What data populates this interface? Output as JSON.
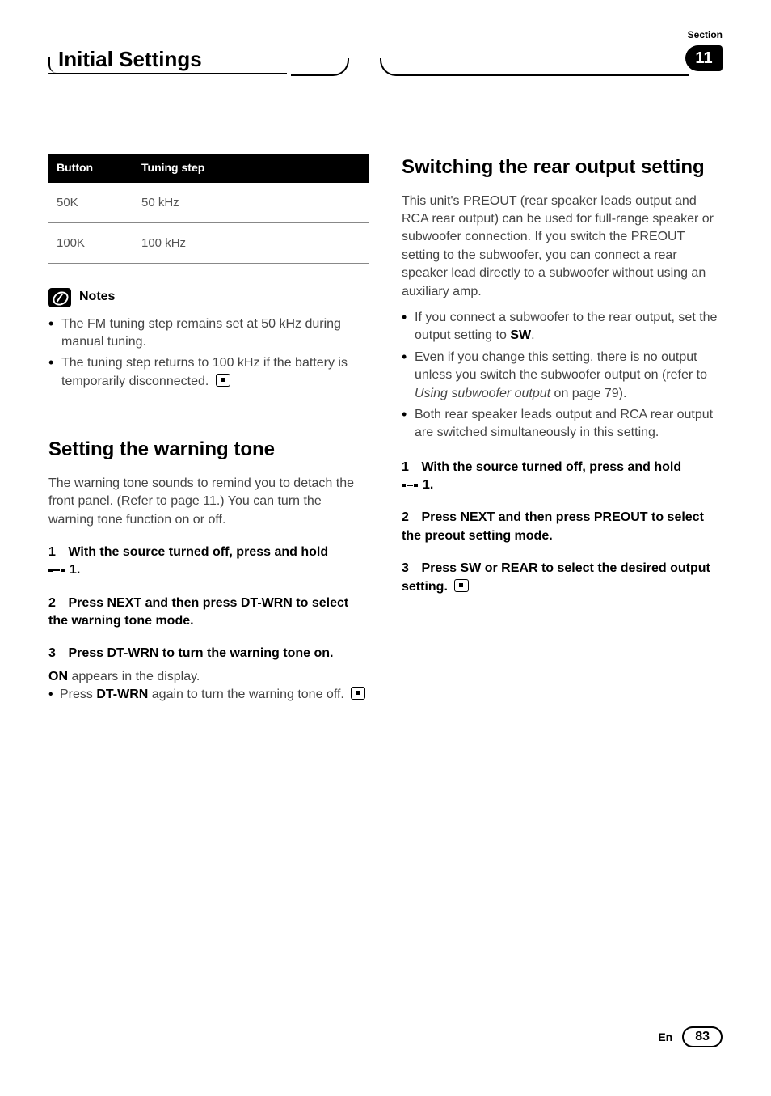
{
  "header": {
    "section_label": "Section",
    "title": "Initial Settings",
    "section_number": "11"
  },
  "left": {
    "table": {
      "headers": [
        "Button",
        "Tuning step"
      ],
      "rows": [
        [
          "50K",
          "50 kHz"
        ],
        [
          "100K",
          "100 kHz"
        ]
      ]
    },
    "notes_title": "Notes",
    "notes": [
      "The FM tuning step remains set at 50 kHz during manual tuning.",
      "The tuning step returns to 100 kHz if the battery is temporarily disconnected."
    ],
    "h2": "Setting the warning tone",
    "intro": "The warning tone sounds to remind you to detach the front panel. (Refer to page 11.) You can turn the warning tone function on or off.",
    "step1_num": "1",
    "step1_text_a": "With the source turned off, press and hold",
    "step1_text_b": "1",
    "step1_text_c": ".",
    "step2_num": "2",
    "step2_a": "Press ",
    "step2_b": "NEXT",
    "step2_c": " and then press ",
    "step2_d": "DT-WRN",
    "step2_e": " to select the warning tone mode.",
    "step3_num": "3",
    "step3_a": "Press ",
    "step3_b": "DT-WRN",
    "step3_c": " to turn the warning tone on.",
    "step3_line2_a": "ON",
    "step3_line2_b": " appears in the display.",
    "step3_sub_a": "Press ",
    "step3_sub_b": "DT-WRN",
    "step3_sub_c": " again to turn the warning tone off."
  },
  "right": {
    "h2": "Switching the rear output setting",
    "intro": "This unit's PREOUT (rear speaker leads output and RCA rear output) can be used for full-range speaker or subwoofer connection. If you switch the PREOUT setting to the subwoofer, you can connect a rear speaker lead directly to a subwoofer without using an auxiliary amp.",
    "bul1_a": "If you connect a subwoofer to the rear output, set the output setting to ",
    "bul1_b": "SW",
    "bul1_c": ".",
    "bul2_a": "Even if you change this setting, there is no output unless you switch the subwoofer output on (refer to ",
    "bul2_b": "Using subwoofer output",
    "bul2_c": " on page 79).",
    "bul3": "Both rear speaker leads output and RCA rear output are switched simultaneously in this setting.",
    "step1_num": "1",
    "step1_text_a": "With the source turned off, press and hold",
    "step1_text_b": "1",
    "step1_text_c": ".",
    "step2_num": "2",
    "step2_a": "Press ",
    "step2_b": "NEXT",
    "step2_c": " and then press ",
    "step2_d": "PREOUT",
    "step2_e": " to select the preout setting mode.",
    "step3_num": "3",
    "step3_a": "Press ",
    "step3_b": "SW",
    "step3_c": " or ",
    "step3_d": "REAR",
    "step3_e": " to select the desired output setting."
  },
  "footer": {
    "lang": "En",
    "page": "83"
  }
}
